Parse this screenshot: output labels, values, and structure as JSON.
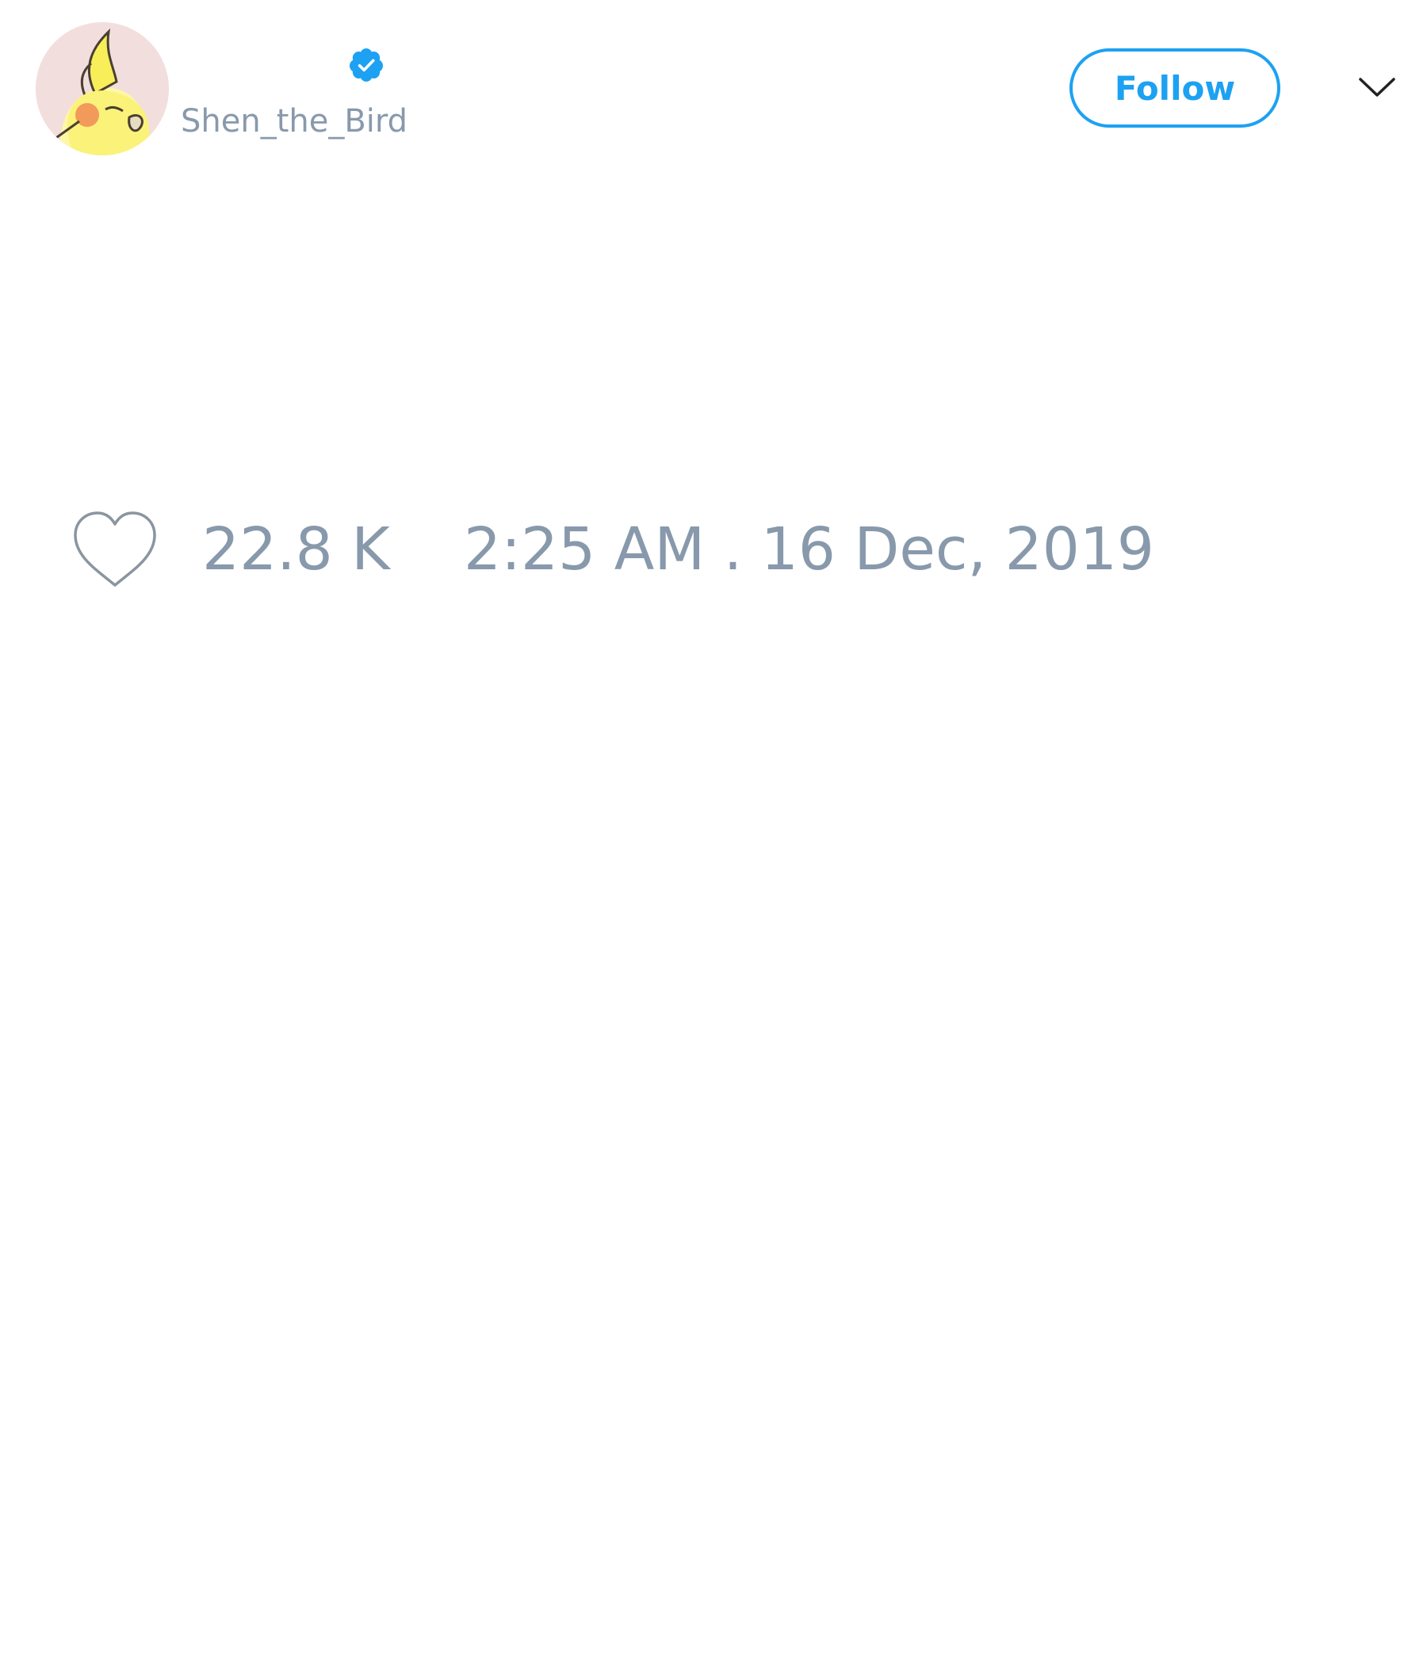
{
  "tweet": {
    "author": {
      "handle": "Shen_the_Bird",
      "verified": true,
      "avatar_icon": "cockatiel-avatar-icon"
    },
    "follow_label": "Follow",
    "menu_icon": "chevron-down-icon",
    "likes": {
      "icon": "heart-icon",
      "count": "22.8 K"
    },
    "timestamp": "2:25 AM . 16 Dec, 2019"
  },
  "colors": {
    "accent": "#1da1f2",
    "muted_text": "#8899ac",
    "background": "#ffffff"
  }
}
